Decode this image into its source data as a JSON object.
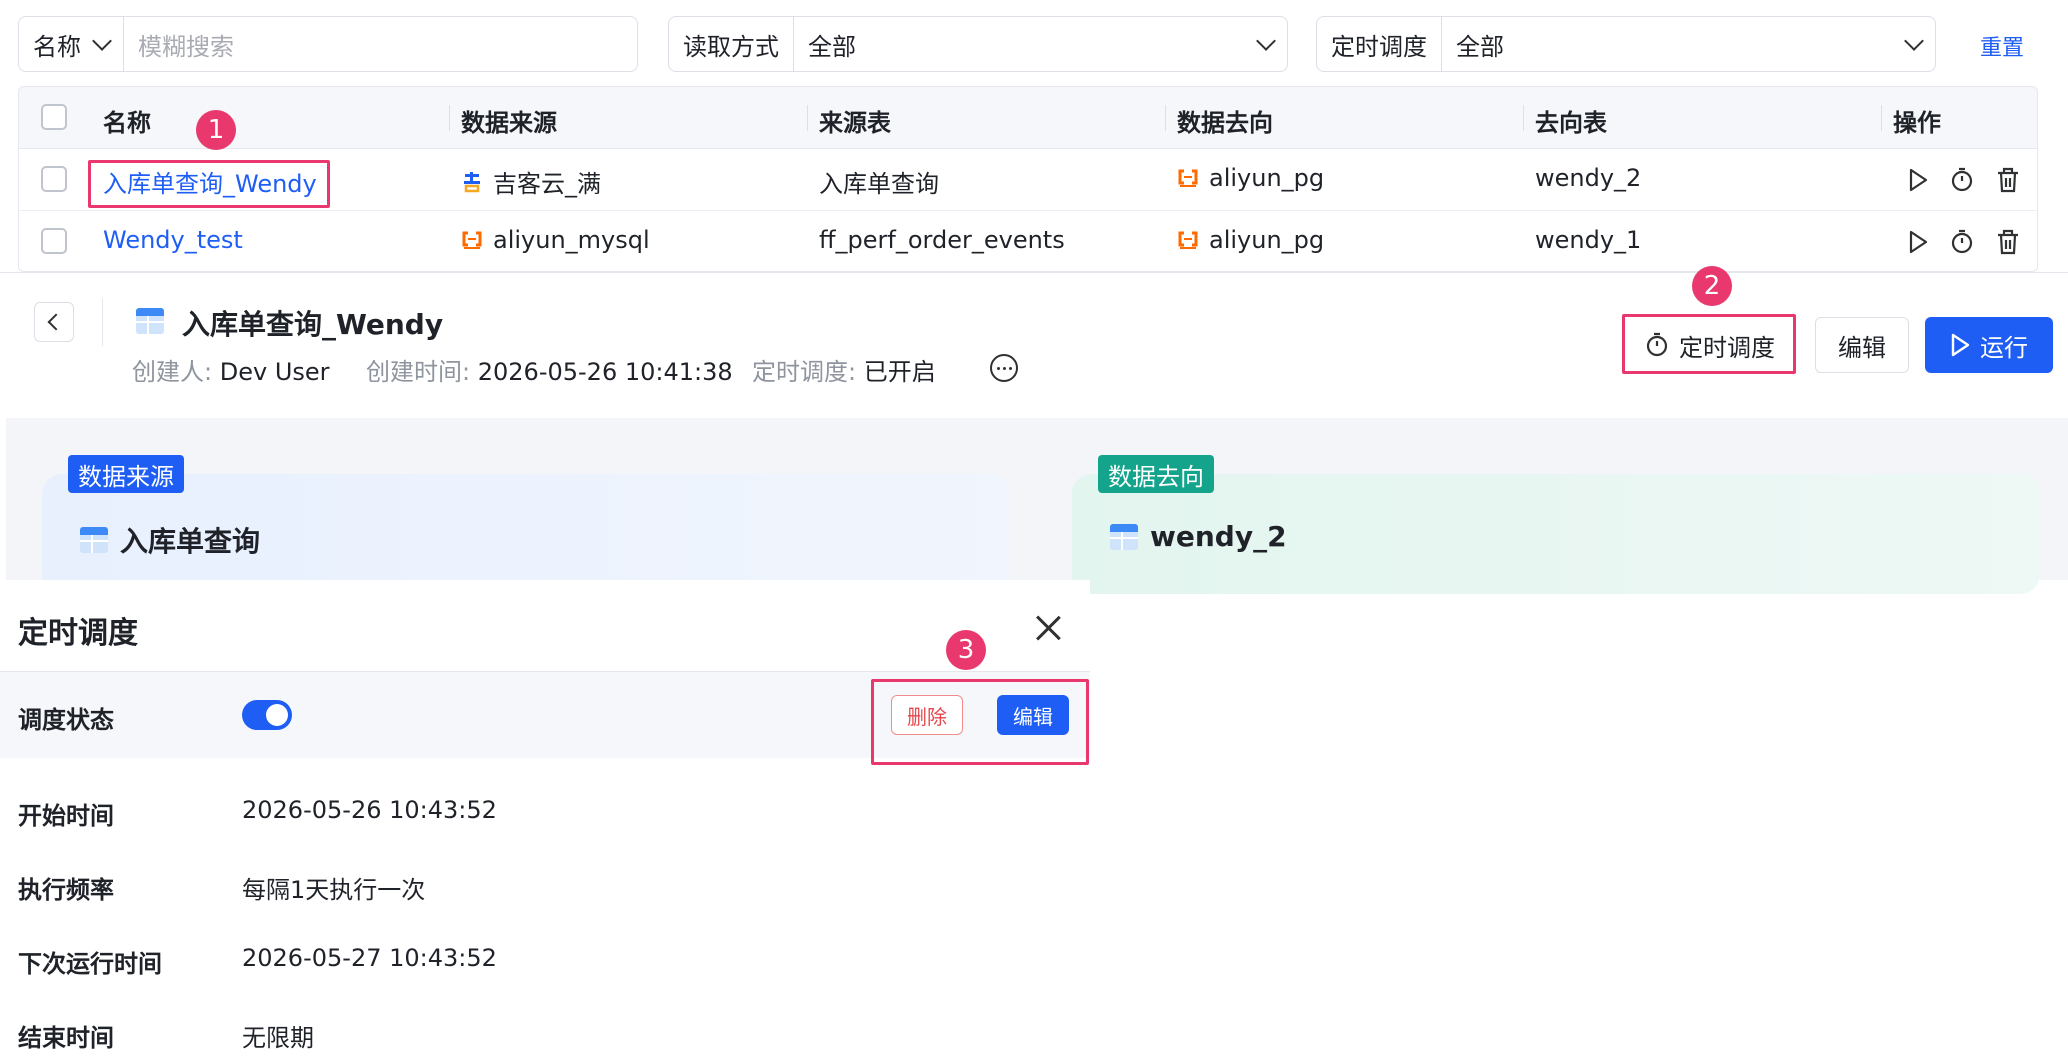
{
  "filters": {
    "name_filter": {
      "field": "名称",
      "placeholder": "模糊搜索"
    },
    "read_mode": {
      "label": "读取方式",
      "value": "全部"
    },
    "schedule": {
      "label": "定时调度",
      "value": "全部"
    },
    "reset_label": "重置"
  },
  "table": {
    "columns": [
      "名称",
      "数据来源",
      "来源表",
      "数据去向",
      "去向表",
      "操作"
    ],
    "rows": [
      {
        "name": "入库单查询_Wendy",
        "source": "吉客云_满",
        "source_table": "入库单查询",
        "target": "aliyun_pg",
        "target_table": "wendy_2"
      },
      {
        "name": "Wendy_test",
        "source": "aliyun_mysql",
        "source_table": "ff_perf_order_events",
        "target": "aliyun_pg",
        "target_table": "wendy_1"
      }
    ]
  },
  "detail": {
    "title": "入库单查询_Wendy",
    "creator_label": "创建人:",
    "creator": "Dev User",
    "created_label": "创建时间:",
    "created": "2026-05-26 10:41:38",
    "schedule_label": "定时调度:",
    "schedule_status": "已开启",
    "schedule_button": "定时调度",
    "edit_button": "编辑",
    "run_button": "运行",
    "source_tag": "数据来源",
    "source_title": "入库单查询",
    "target_tag": "数据去向",
    "target_title": "wendy_2"
  },
  "drawer": {
    "title": "定时调度",
    "status_label": "调度状态",
    "status_on": true,
    "delete_button": "删除",
    "edit_button": "编辑",
    "fields": [
      {
        "label": "开始时间",
        "value": "2026-05-26 10:43:52"
      },
      {
        "label": "执行频率",
        "value": "每隔1天执行一次"
      },
      {
        "label": "下次运行时间",
        "value": "2026-05-27 10:43:52"
      },
      {
        "label": "结束时间",
        "value": "无限期"
      }
    ]
  },
  "annotations": [
    "1",
    "2",
    "3"
  ],
  "colors": {
    "accent": "#1f5ef5",
    "highlight": "#e8386d",
    "source_tag": "#1f5ef5",
    "target_tag": "#14a38b"
  }
}
